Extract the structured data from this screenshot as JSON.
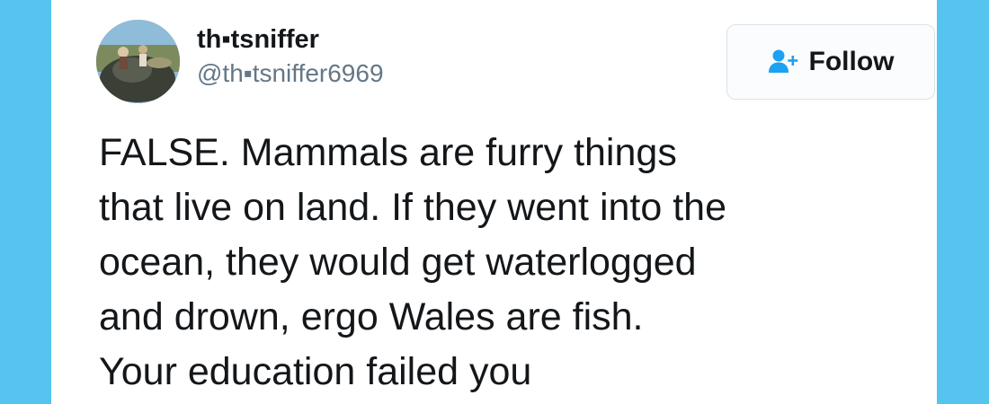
{
  "tweet": {
    "display_name": "th▪tsniffer",
    "handle": "@th▪tsniffer6969",
    "text": "FALSE. Mammals are furry things\nthat live on land. If they went into the\nocean, they would get waterlogged\nand drown, ergo Wales are fish.\nYour education failed you"
  },
  "follow_button": {
    "label": "Follow",
    "icon": "add-user-icon"
  },
  "colors": {
    "background": "#55c4ee",
    "card": "#ffffff",
    "text": "#14171a",
    "handle": "#657786",
    "accent": "#1da1f2"
  }
}
